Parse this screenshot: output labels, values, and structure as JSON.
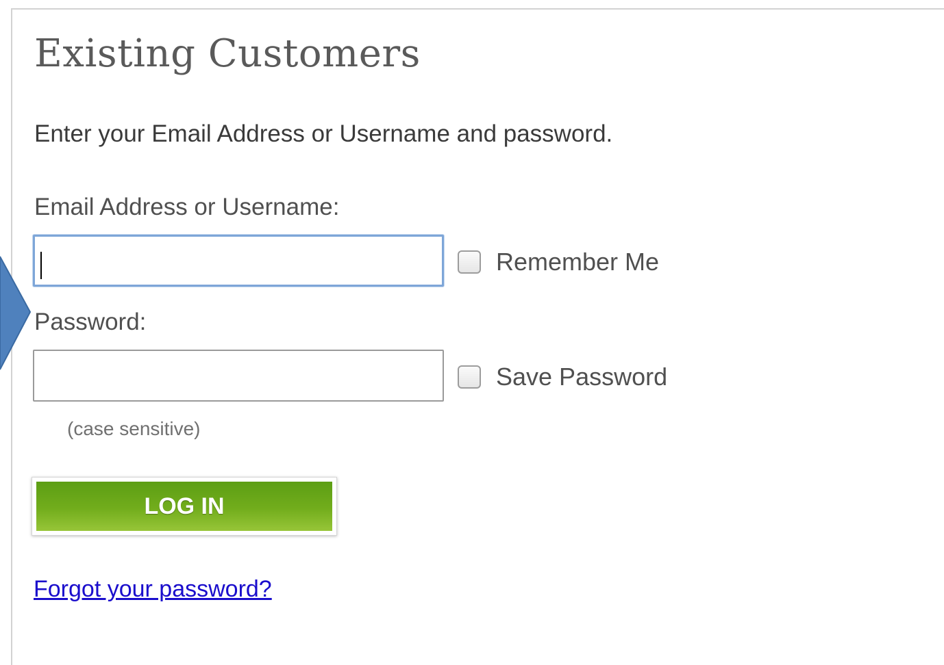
{
  "login": {
    "title": "Existing Customers",
    "intro": "Enter your Email Address or Username and password.",
    "email_label": "Email Address or Username:",
    "email_value": "",
    "remember_label": "Remember Me",
    "password_label": "Password:",
    "password_value": "",
    "save_password_label": "Save Password",
    "case_hint": "(case sensitive)",
    "login_button": "LOG IN",
    "forgot_link": "Forgot your password?"
  },
  "colors": {
    "button_green": "#72ad1c",
    "focus_border": "#7ea6d8",
    "link_blue": "#1a0dcc",
    "pointer_blue": "#4f81bd"
  },
  "icons": {
    "pointer": "callout-arrow-icon"
  }
}
